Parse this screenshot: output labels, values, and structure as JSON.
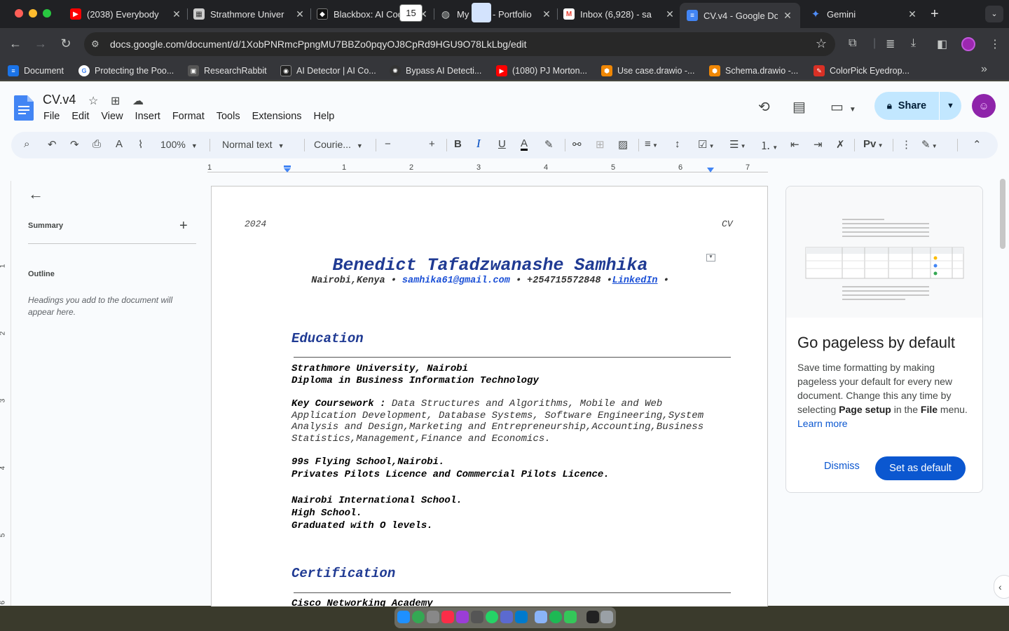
{
  "browser": {
    "tabs": [
      {
        "title": "(2038) Everybody",
        "icon": "youtube-icon",
        "color": "#ff0000"
      },
      {
        "title": "Strathmore Univer",
        "icon": "university-icon",
        "color": "#cccccc"
      },
      {
        "title": "Blackbox: AI Code",
        "icon": "blackbox-icon",
        "color": "#111111"
      },
      {
        "title": "My Web - Portfolio",
        "icon": "globe-icon",
        "color": "#5f6368"
      },
      {
        "title": "Inbox (6,928) - sa",
        "icon": "gmail-icon",
        "color": "#ea4335"
      },
      {
        "title": "CV.v4 - Google Do",
        "icon": "docs-icon",
        "color": "#4285f4",
        "active": true
      },
      {
        "title": "Gemini",
        "icon": "gemini-icon",
        "color": "#4f8df9"
      }
    ],
    "url": "docs.google.com/document/d/1XobPNRmcPpngMU7BBZo0pqyOJ8CpRd9HGU9O78LkLbg/edit",
    "bookmarks": [
      {
        "label": "Document",
        "color": "#1a73e8"
      },
      {
        "label": "Protecting the Poo...",
        "color": "#4285f4"
      },
      {
        "label": "ResearchRabbit",
        "color": "#555555"
      },
      {
        "label": "AI Detector | AI Co...",
        "color": "#222222"
      },
      {
        "label": "Bypass AI Detecti...",
        "color": "#333333"
      },
      {
        "label": "(1080) PJ Morton...",
        "color": "#ff0000"
      },
      {
        "label": "Use case.drawio -...",
        "color": "#f08705"
      },
      {
        "label": "Schema.drawio -...",
        "color": "#f08705"
      },
      {
        "label": "ColorPick Eyedrop...",
        "color": "#d93025"
      }
    ]
  },
  "docs": {
    "title": "CV.v4",
    "menu": [
      "File",
      "Edit",
      "View",
      "Insert",
      "Format",
      "Tools",
      "Extensions",
      "Help"
    ],
    "share_label": "Share",
    "toolbar": {
      "zoom": "100%",
      "style": "Normal text",
      "font": "Courie...",
      "font_size": "15"
    },
    "ruler_numbers": [
      "1",
      "1",
      "2",
      "3",
      "4",
      "5",
      "6",
      "7"
    ],
    "vruler_numbers": [
      "1",
      "2",
      "3",
      "4",
      "5",
      "6"
    ]
  },
  "outline": {
    "summary_label": "Summary",
    "outline_label": "Outline",
    "hint": "Headings you add to the document will appear here."
  },
  "document": {
    "header_left": "2024",
    "header_right": "CV",
    "name": "Benedict Tafadzwanashe Samhika",
    "contact": {
      "location": "Nairobi,Kenya",
      "bullet": "•",
      "email": "samhika61@gmail.com",
      "phone": "+254715572848",
      "linkedin": "LinkedIn"
    },
    "sections": {
      "education_title": "Education",
      "edu1_line1": "Strathmore University, Nairobi",
      "edu1_line2": "Diploma in Business Information Technology",
      "coursework_label": "Key Coursework :",
      "coursework_text": " Data Structures and Algorithms, Mobile and Web Application Development, Database Systems, Software Engineering,System Analysis and Design,Marketing and Entrepreneurship,Accounting,Business Statistics,Management,Finance and Economics.",
      "edu2_line1": "99s Flying School,Nairobi.",
      "edu2_line2": "Privates Pilots Licence and Commercial Pilots Licence.",
      "edu3_line1": "Nairobi International School.",
      "edu3_line2": "High School.",
      "edu3_line3": "Graduated with O levels.",
      "certification_title": "Certification",
      "cert1_line1": "Cisco Networking Academy"
    }
  },
  "promo": {
    "title": "Go pageless by default",
    "text_1": "Save time formatting by making pageless your default for every new document. Change this any time by selecting ",
    "bold_1": "Page setup",
    "text_2": " in the ",
    "bold_2": "File",
    "text_3": " menu. ",
    "link": "Learn more",
    "dismiss": "Dismiss",
    "set_default": "Set as default"
  }
}
